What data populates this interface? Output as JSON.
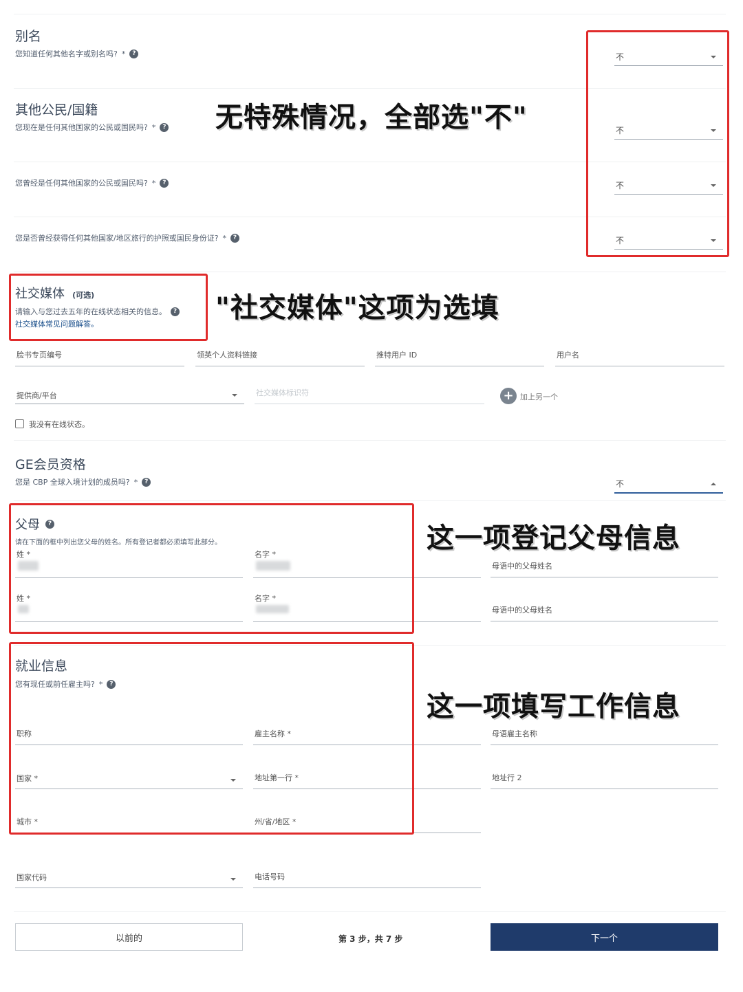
{
  "aliases": {
    "title": "别名",
    "question": "您知道任何其他名字或别名吗?",
    "value": "不"
  },
  "citizenship": {
    "title": "其他公民/国籍",
    "q1": "您现在是任何其他国家的公民或国民吗?",
    "q1_value": "不",
    "q2": "您曾经是任何其他国家的公民或国民吗?",
    "q2_value": "不",
    "q3": "您是否曾经获得任何其他国家/地区旅行的护照或国民身份证?",
    "q3_value": "不"
  },
  "social": {
    "title": "社交媒体",
    "optional": "(可选)",
    "desc": "请输入与您过去五年的在线状态相关的信息。",
    "faq_link": "社交媒体常见问题解答。",
    "fields": [
      "脸书专页编号",
      "领英个人资料链接",
      "推特用户 ID",
      "用户名"
    ],
    "provider_label": "提供商/平台",
    "identifier_placeholder": "社交媒体标识符",
    "add_another": "加上另一个",
    "no_presence": "我没有在线状态。"
  },
  "ge": {
    "title": "GE会员资格",
    "question": "您是 CBP 全球入境计划的成员吗?",
    "value": "不"
  },
  "parents": {
    "title": "父母",
    "desc": "请在下面的框中列出您父母的姓名。所有登记者都必须填写此部分。",
    "surname_label": "姓",
    "given_label": "名字",
    "native_label": "母语中的父母姓名"
  },
  "employment": {
    "title": "就业信息",
    "question": "您有现任或前任雇主吗?",
    "job_title": "职称",
    "employer_name": "雇主名称",
    "employer_native": "母语雇主名称",
    "country": "国家",
    "address1": "地址第一行",
    "address2": "地址行 2",
    "city": "城市",
    "state": "州/省/地区",
    "country_code": "国家代码",
    "phone": "电话号码"
  },
  "footer": {
    "prev": "以前的",
    "step": "第 3 步，共 7 步",
    "next": "下一个"
  },
  "annotations": {
    "note1": "无特殊情况，全部选\"不\"",
    "note2": "\"社交媒体\"这项为选填",
    "note3": "这一项登记父母信息",
    "note4": "这一项填写工作信息"
  },
  "required_mark": "*",
  "help_glyph": "?",
  "colors": {
    "annotation_border": "#e02b2b",
    "primary_button": "#1f3b6b",
    "link": "#1a4f8b"
  }
}
